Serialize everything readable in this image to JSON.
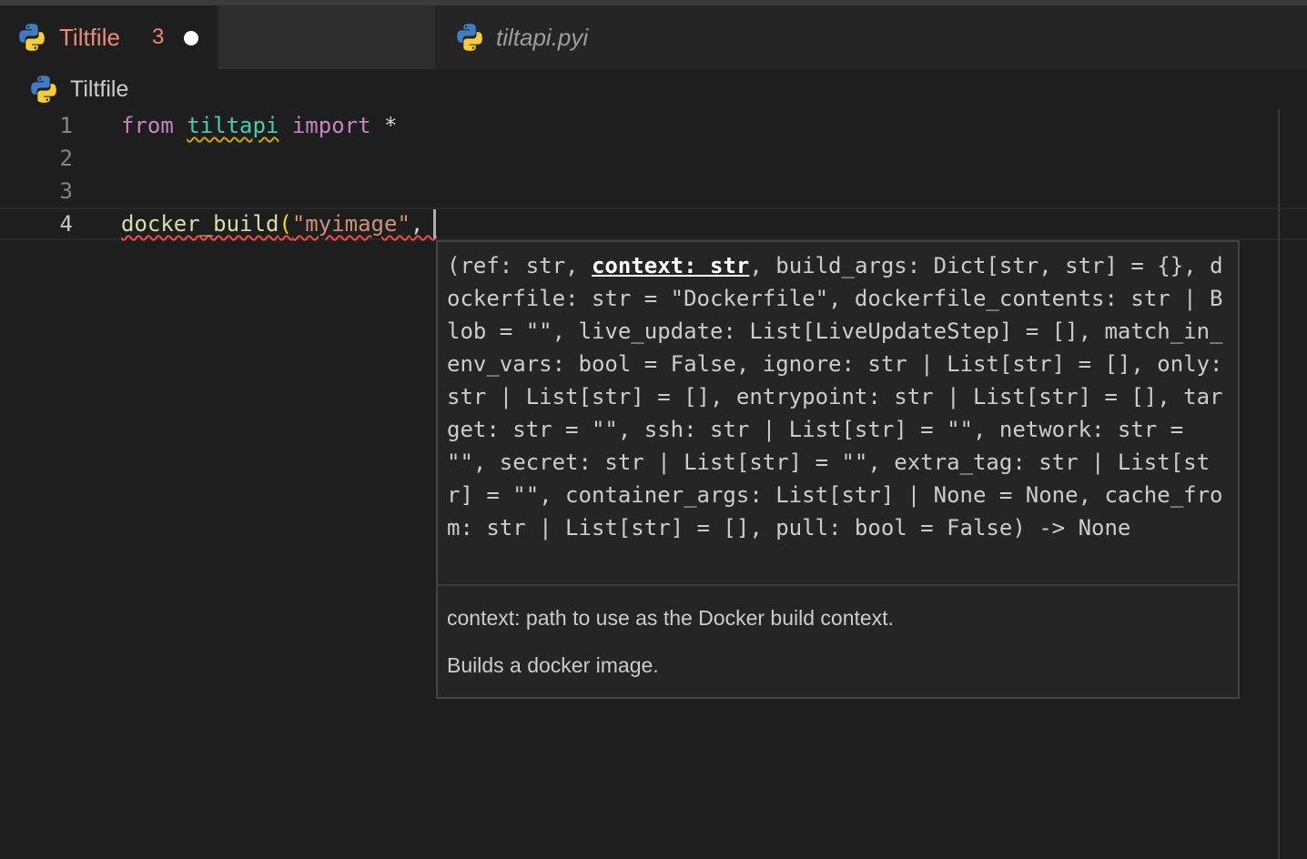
{
  "tabs": [
    {
      "title": "Tiltfile",
      "problem_count": "3",
      "active": true,
      "dirty": true,
      "color": "#f48771"
    },
    {
      "title": "tiltapi.pyi",
      "active": false
    }
  ],
  "breadcrumb": {
    "label": "Tiltfile"
  },
  "editor": {
    "lines": [
      {
        "number": "1",
        "tokens": [
          "from",
          " ",
          "tiltapi",
          " ",
          "import",
          " *"
        ]
      },
      {
        "number": "2",
        "text": ""
      },
      {
        "number": "3",
        "text": ""
      },
      {
        "number": "4",
        "tokens": [
          "docker_build",
          "(",
          "\"myimage\"",
          ", "
        ]
      }
    ]
  },
  "signature_help": {
    "signature_before": "(ref: str, ",
    "active_parameter": "context: str",
    "signature_after": ", build_args: Dict[str, str] = {}, dockerfile: str = \"Dockerfile\", dockerfile_contents: str | Blob = \"\", live_update: List[LiveUpdateStep] = [], match_in_env_vars: bool = False, ignore: str | List[str] = [], only: str | List[str] = [], entrypoint: str | List[str] = [], target: str = \"\", ssh: str | List[str] = \"\", network: str = \"\", secret: str | List[str] = \"\", extra_tag: str | List[str] = \"\", container_args: List[str] | None = None, cache_from: str | List[str] = [], pull: bool = False) -> None",
    "param_doc": "context: path to use as the Docker build context.",
    "description": "Builds a docker image."
  },
  "colors": {
    "keyword": "#c586c0",
    "module": "#4ec9b0",
    "function": "#dcdcaa",
    "string": "#ce9178",
    "error_tab": "#f48771"
  },
  "icons": [
    "python-icon"
  ]
}
